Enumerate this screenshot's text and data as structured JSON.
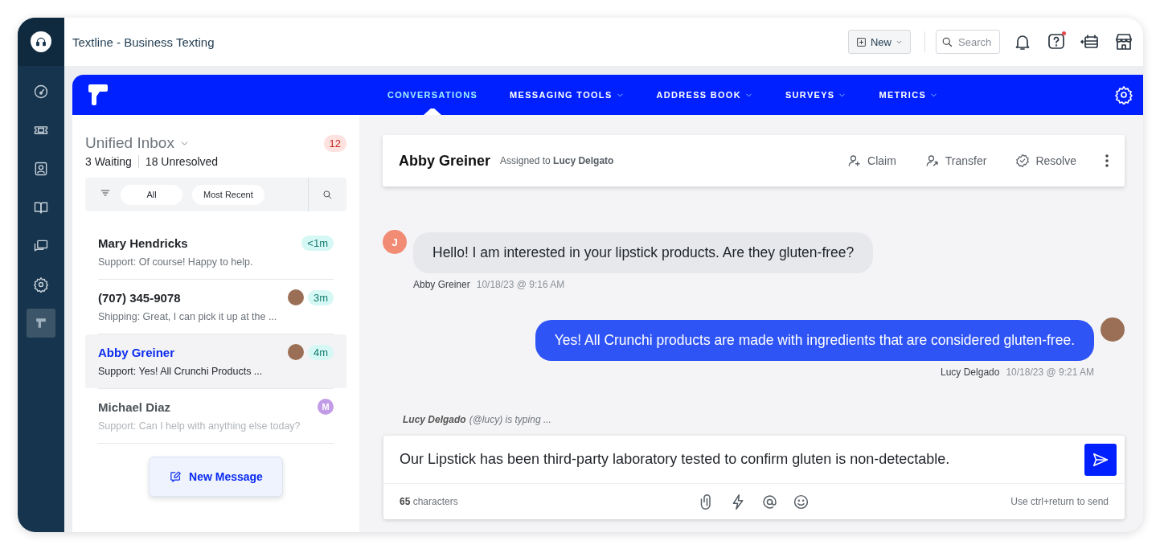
{
  "window": {
    "title": "Textline - Business Texting"
  },
  "sidebar": {
    "items": [
      {
        "selected": false
      },
      {
        "selected": false
      },
      {
        "selected": false
      },
      {
        "selected": false
      },
      {
        "selected": false
      },
      {
        "selected": false
      },
      {
        "selected": true
      }
    ]
  },
  "topbar": {
    "new_button": "New",
    "search": {
      "placeholder": "Search"
    },
    "help_has_alert": true
  },
  "nav": {
    "tabs": [
      {
        "label": "CONVERSATIONS",
        "selected": true,
        "dropdown": false
      },
      {
        "label": "MESSAGING TOOLS",
        "selected": false,
        "dropdown": true
      },
      {
        "label": "ADDRESS BOOK",
        "selected": false,
        "dropdown": true
      },
      {
        "label": "SURVEYS",
        "selected": false,
        "dropdown": true
      },
      {
        "label": "METRICS",
        "selected": false,
        "dropdown": true
      }
    ]
  },
  "inbox": {
    "title": "Unified Inbox",
    "count": "12",
    "waiting": "3",
    "waiting_label": "Waiting",
    "unresolved": "18",
    "unresolved_label": "Unresolved",
    "filters": [
      {
        "label": "All"
      },
      {
        "label": "Most Recent"
      }
    ],
    "conversations": [
      {
        "name": "Mary Hendricks",
        "preview": "Support: Of course! Happy to help.",
        "time": "<1m",
        "avatar": {
          "kind": "none"
        },
        "selected": false,
        "faded": false
      },
      {
        "name": "(707) 345-9078",
        "preview": "Shipping: Great, I can pick it up at the ...",
        "time": "3m",
        "avatar": {
          "kind": "photo"
        },
        "selected": false,
        "faded": false
      },
      {
        "name": "Abby Greiner",
        "preview": "Support: Yes! All Crunchi Products ...",
        "time": "4m",
        "avatar": {
          "kind": "photo"
        },
        "selected": true,
        "faded": false
      },
      {
        "name": "Michael Diaz",
        "preview": "Support: Can I help with anything else today?",
        "avatar": {
          "kind": "letter",
          "letter": "M",
          "color": "#c29ce6"
        },
        "selected": false,
        "faded": true
      }
    ],
    "new_message": "New Message"
  },
  "conversation": {
    "contact": "Abby Greiner",
    "assigned_label": "Assigned to",
    "assignee": "Lucy Delgato",
    "actions": [
      {
        "label": "Claim"
      },
      {
        "label": "Transfer"
      },
      {
        "label": "Resolve"
      }
    ],
    "messages": [
      {
        "kind": "incoming",
        "text": "Hello! I am interested in your lipstick products. Are they gluten-free?",
        "sender": "Abby Greiner",
        "time": "10/18/23 @ 9:16 AM",
        "avatar": {
          "kind": "letter",
          "letter": "J",
          "color": "#f28b74"
        }
      },
      {
        "kind": "outgoing",
        "text": "Yes! All Crunchi products are made with ingredients that are considered gluten-free.",
        "sender": "Lucy Delgado",
        "time": "10/18/23 @ 9:21 AM",
        "avatar": {
          "kind": "photo"
        }
      }
    ],
    "typing": {
      "name": "Lucy Delgado",
      "handle": "(@lucy)",
      "suffix": "is typing ..."
    },
    "composer": {
      "value": "Our Lipstick has been third-party laboratory tested to confirm gluten is non-detectable.",
      "count": "65",
      "count_label": "characters",
      "hint": "Use ctrl+return to send"
    }
  }
}
